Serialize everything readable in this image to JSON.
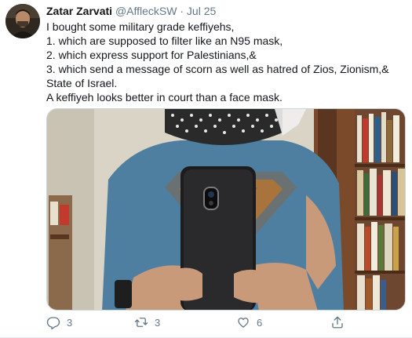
{
  "tweet": {
    "author_name": "Zatar Zarvati",
    "handle": "@AffleckSW",
    "separator": "·",
    "date": "Jul 25",
    "lines": [
      "I bought some military grade keffiyehs,",
      "1. which are supposed to filter like an N95 mask,",
      "2. which express support for Palestinians,&",
      "3. which send a message of scorn as well as hatred of Zios, Zionism,& State of Israel.",
      "A keffiyeh looks better in court than a face mask."
    ]
  },
  "actions": {
    "reply_count": "3",
    "retweet_count": "3",
    "like_count": "6"
  },
  "icons": [
    "reply-icon",
    "retweet-icon",
    "like-icon",
    "share-icon"
  ],
  "colors": {
    "secondary_text": "#657786",
    "primary_text": "#14171a"
  }
}
